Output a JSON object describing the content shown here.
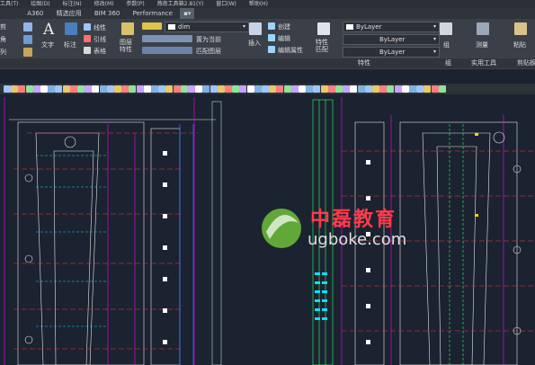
{
  "menubar": {
    "items": [
      "工具(T)",
      "绘图(D)",
      "标注(N)",
      "修改(M)",
      "参数(P)",
      "燕南工具箱2.81(Y)",
      "窗口(W)",
      "帮助(H)"
    ]
  },
  "tabs": [
    "A360",
    "精选应用",
    "BIM 360",
    "Performance"
  ],
  "ribbon": {
    "left_labels": [
      "剪",
      "角",
      "列"
    ],
    "text_label": "文字",
    "dim_label": "标注",
    "line_label": "线性",
    "leader_label": "引线",
    "table_label": "表格",
    "props_label": "图层\n特性",
    "layer_name": "dim",
    "set_current": "置为当前",
    "match_layer": "匹配图层",
    "insert": "插入",
    "create": "创建",
    "edit": "编辑",
    "edit_attr": "编辑属性",
    "match_props": "特性\n匹配",
    "bylayer_color": "ByLayer",
    "bylayer_line": "ByLayer",
    "bylayer_weight": "ByLayer",
    "group": "组",
    "measure": "测量",
    "paste": "粘贴",
    "panel_props": "特性",
    "panel_group": "组",
    "panel_util": "实用工具",
    "panel_clip": "剪贴板"
  },
  "watermark": {
    "cn": "中磊教育",
    "url": "ugboke.com"
  },
  "colors": {
    "canvas": "#1b2230",
    "magenta": "#ff00ff",
    "cyan": "#00e5ff",
    "green": "#33ff66",
    "red": "#ff3b3b",
    "yellow": "#ffd700",
    "white": "#e8e8e8",
    "blue": "#3b6bff"
  }
}
